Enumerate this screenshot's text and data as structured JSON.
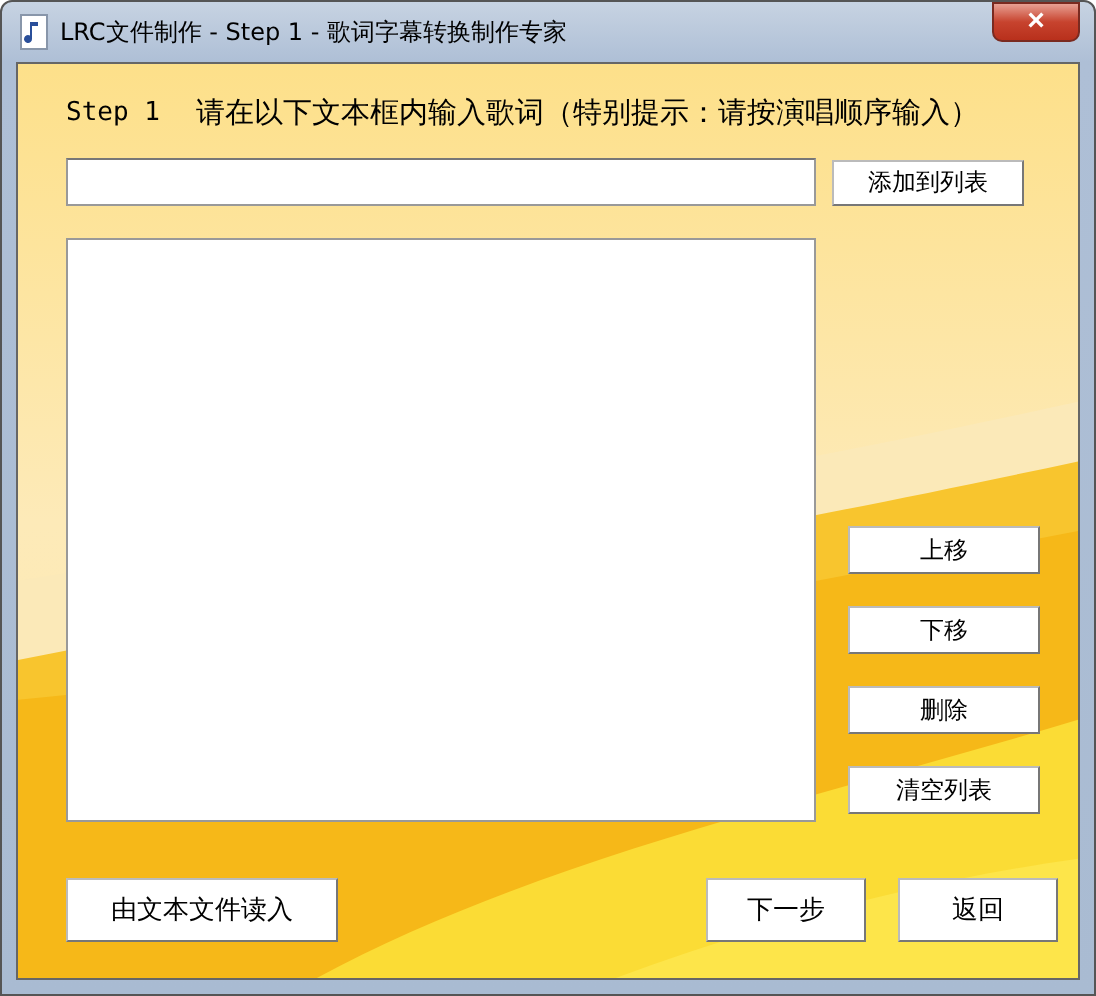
{
  "window": {
    "title": "LRC文件制作 - Step 1 - 歌词字幕转换制作专家",
    "close": "×"
  },
  "heading": {
    "step": "Step 1",
    "text": "请在以下文本框内输入歌词（特别提示：请按演唱顺序输入）"
  },
  "add_button": "添加到列表",
  "list_buttons": [
    "上移",
    "下移",
    "删除",
    "清空列表"
  ],
  "bottom_buttons": {
    "left": "由文本文件读入",
    "right": [
      "下一步",
      "返回"
    ]
  }
}
